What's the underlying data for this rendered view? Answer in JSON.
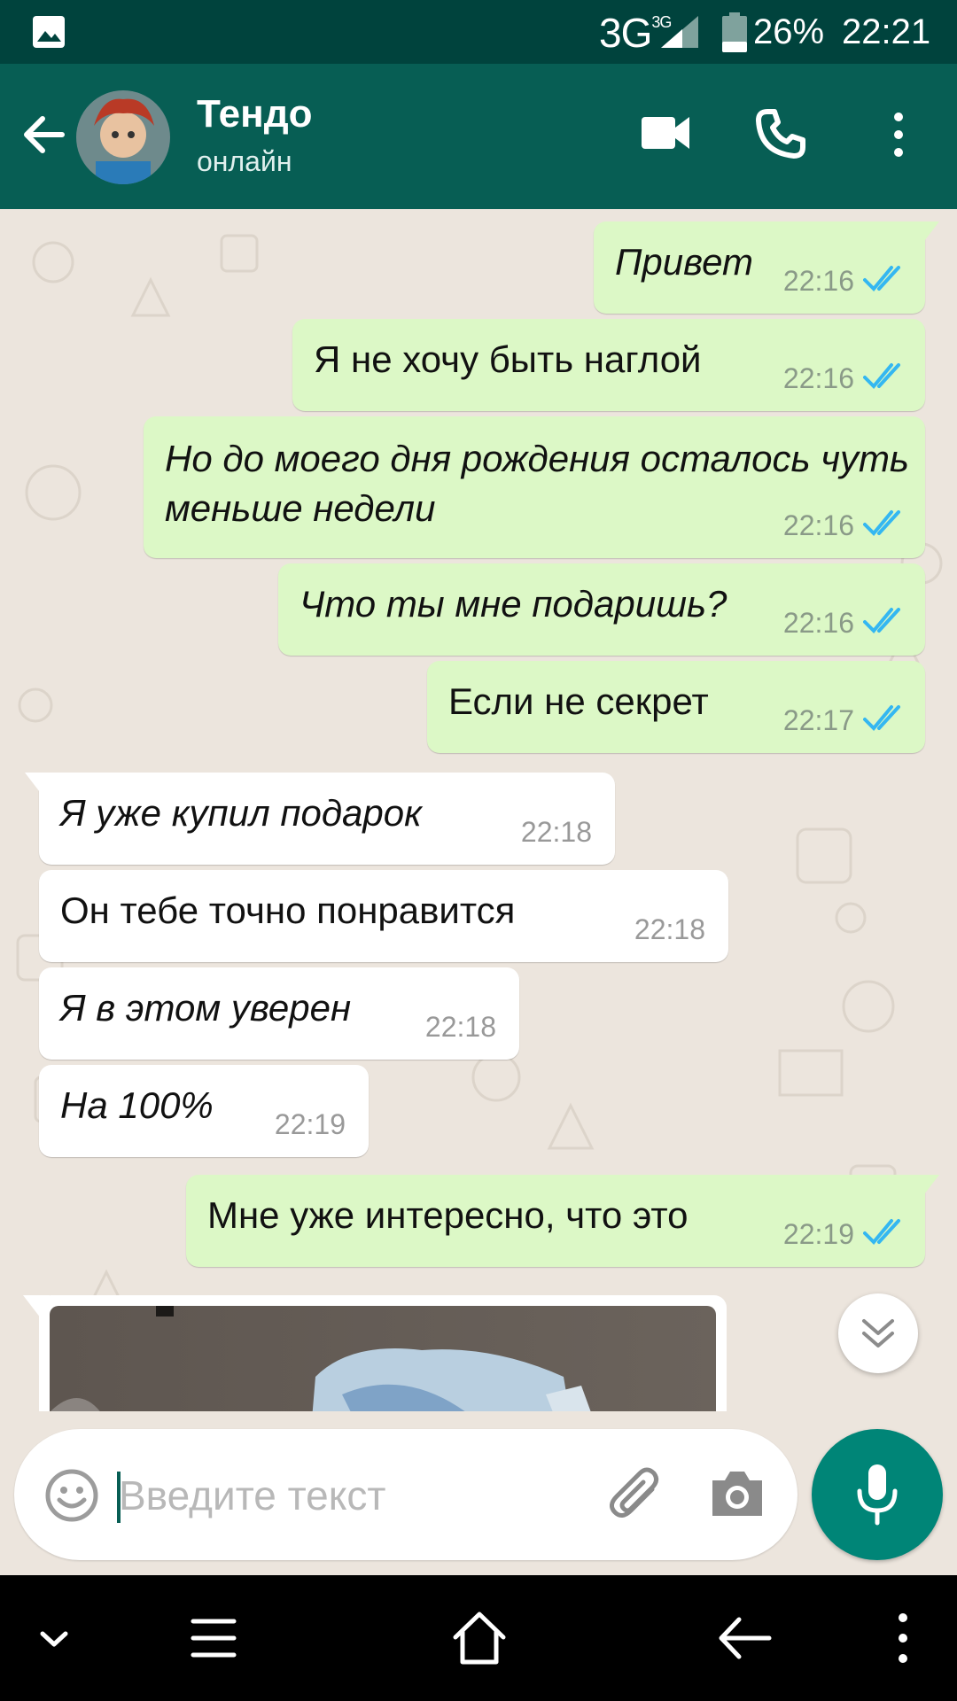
{
  "status_bar": {
    "network": "3G",
    "network_sup": "3G",
    "battery": "26%",
    "time": "22:21",
    "icons": [
      "image-icon",
      "signal-icon",
      "battery-icon"
    ]
  },
  "header": {
    "contact_name": "Тендо",
    "contact_status": "онлайн",
    "icons": [
      "back-arrow-icon",
      "avatar",
      "video-call-icon",
      "phone-icon",
      "more-vert-icon"
    ]
  },
  "messages": [
    {
      "direction": "out",
      "text": "Привет",
      "time": "22:16",
      "italic": true
    },
    {
      "direction": "out",
      "text": "Я не хочу быть наглой",
      "time": "22:16",
      "italic": false
    },
    {
      "direction": "out",
      "text": "Но до моего дня рождения осталось чуть меньше недели",
      "time": "22:16",
      "italic": true
    },
    {
      "direction": "out",
      "text": "Что ты мне подаришь?",
      "time": "22:16",
      "italic": true
    },
    {
      "direction": "out",
      "text": "Если не секрет",
      "time": "22:17",
      "italic": false
    },
    {
      "direction": "in",
      "text": "Я уже купил подарок",
      "time": "22:18",
      "italic": true
    },
    {
      "direction": "in",
      "text": "Он тебе точно понравится",
      "time": "22:18",
      "italic": false
    },
    {
      "direction": "in",
      "text": "Я в этом уверен",
      "time": "22:18",
      "italic": true
    },
    {
      "direction": "in",
      "text": "На 100%",
      "time": "22:19",
      "italic": true
    },
    {
      "direction": "out",
      "text": "Мне уже интересно, что это",
      "time": "22:19",
      "italic": false
    }
  ],
  "input": {
    "placeholder": "Введите текст",
    "value": ""
  },
  "colors": {
    "status_bar": "#00433d",
    "header": "#075e54",
    "chat_bg": "#ece5dd",
    "outgoing": "#dcf8c6",
    "incoming": "#ffffff",
    "read_ticks": "#34b7f1",
    "mic_button": "#008577"
  },
  "nav_bar": {
    "icons": [
      "chevron-down-icon",
      "menu-icon",
      "home-icon",
      "back-icon",
      "more-vert-icon"
    ]
  }
}
